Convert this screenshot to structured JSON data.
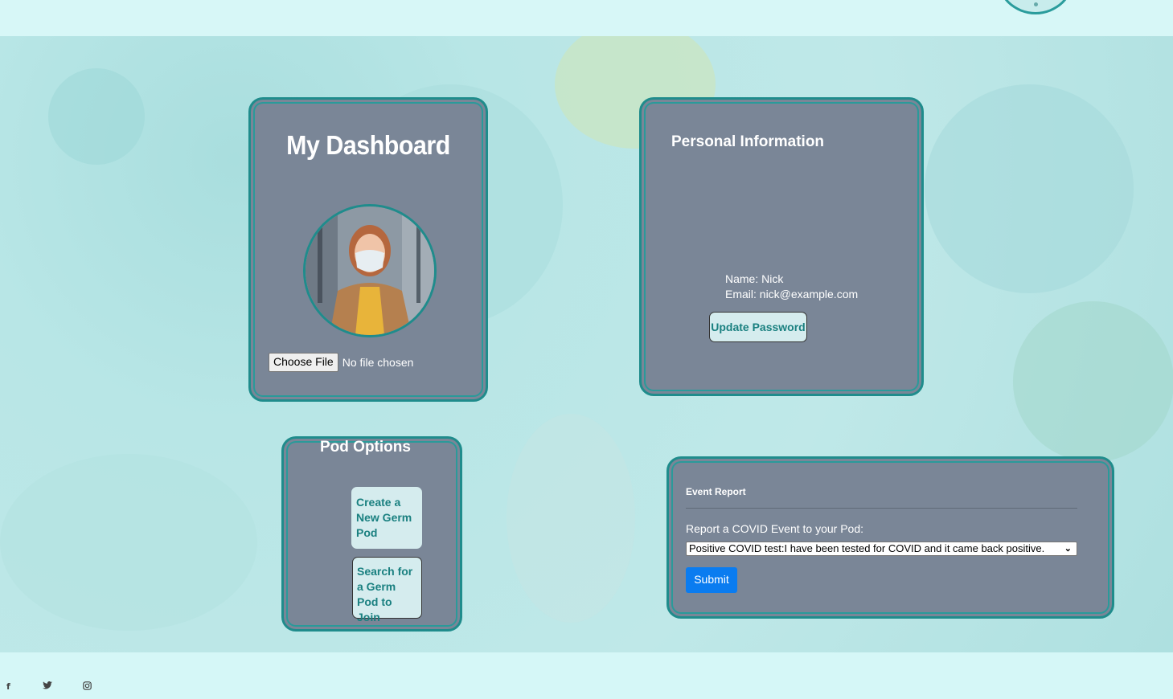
{
  "dashboard": {
    "title": "My Dashboard",
    "file_button": "Choose File",
    "file_status": "No file chosen"
  },
  "personal_info": {
    "title": "Personal Information",
    "name_line": "Name: Nick",
    "email_line": "Email: nick@example.com",
    "update_button": "Update Password"
  },
  "pod_options": {
    "title": "Pod Options",
    "create_button": "Create a New Germ Pod",
    "search_button": "Search for a Germ Pod to Join"
  },
  "event_report": {
    "title": "Event Report",
    "label": "Report a COVID Event to your Pod:",
    "selected_option": "Positive COVID test:I have been tested for COVID and it came back positive.",
    "submit_button": "Submit"
  },
  "footer": {
    "icons": [
      "facebook-icon",
      "twitter-icon",
      "instagram-icon"
    ]
  },
  "colors": {
    "card_bg": "#7a8697",
    "card_border": "#1f8c8c",
    "submit_blue": "#0a7cf0",
    "teal_text": "#1a8080"
  }
}
